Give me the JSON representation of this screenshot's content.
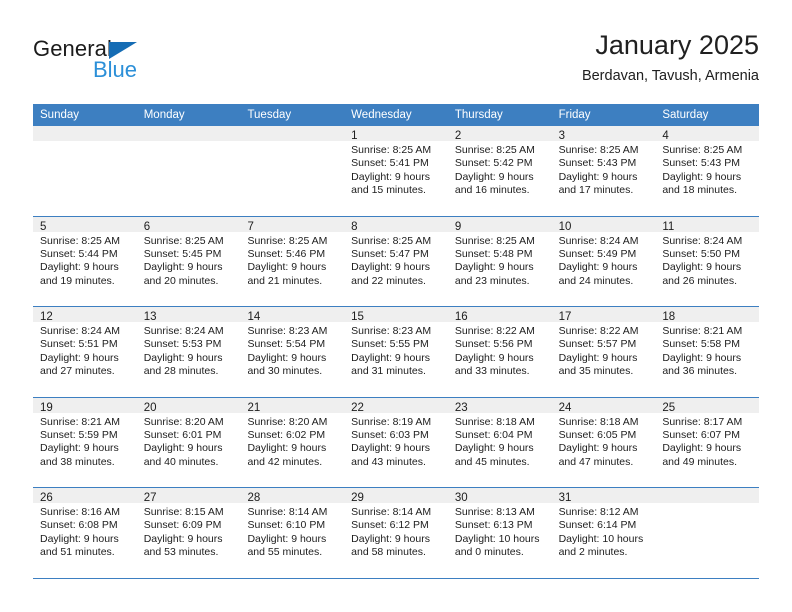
{
  "brand": {
    "name_part1": "General",
    "name_part2": "Blue",
    "logo_icon": "triangle-logo-icon",
    "accent_color": "#2b8fd8",
    "triangle_color": "#156cb4"
  },
  "header": {
    "title": "January 2025",
    "location": "Berdavan, Tavush, Armenia"
  },
  "calendar": {
    "header_bg": "#3d7fc1",
    "day_band_bg": "#efefef",
    "weekdays": [
      "Sunday",
      "Monday",
      "Tuesday",
      "Wednesday",
      "Thursday",
      "Friday",
      "Saturday"
    ],
    "weeks": [
      [
        {
          "day": "",
          "lines": []
        },
        {
          "day": "",
          "lines": []
        },
        {
          "day": "",
          "lines": []
        },
        {
          "day": "1",
          "lines": [
            "Sunrise: 8:25 AM",
            "Sunset: 5:41 PM",
            "Daylight: 9 hours",
            "and 15 minutes."
          ]
        },
        {
          "day": "2",
          "lines": [
            "Sunrise: 8:25 AM",
            "Sunset: 5:42 PM",
            "Daylight: 9 hours",
            "and 16 minutes."
          ]
        },
        {
          "day": "3",
          "lines": [
            "Sunrise: 8:25 AM",
            "Sunset: 5:43 PM",
            "Daylight: 9 hours",
            "and 17 minutes."
          ]
        },
        {
          "day": "4",
          "lines": [
            "Sunrise: 8:25 AM",
            "Sunset: 5:43 PM",
            "Daylight: 9 hours",
            "and 18 minutes."
          ]
        }
      ],
      [
        {
          "day": "5",
          "lines": [
            "Sunrise: 8:25 AM",
            "Sunset: 5:44 PM",
            "Daylight: 9 hours",
            "and 19 minutes."
          ]
        },
        {
          "day": "6",
          "lines": [
            "Sunrise: 8:25 AM",
            "Sunset: 5:45 PM",
            "Daylight: 9 hours",
            "and 20 minutes."
          ]
        },
        {
          "day": "7",
          "lines": [
            "Sunrise: 8:25 AM",
            "Sunset: 5:46 PM",
            "Daylight: 9 hours",
            "and 21 minutes."
          ]
        },
        {
          "day": "8",
          "lines": [
            "Sunrise: 8:25 AM",
            "Sunset: 5:47 PM",
            "Daylight: 9 hours",
            "and 22 minutes."
          ]
        },
        {
          "day": "9",
          "lines": [
            "Sunrise: 8:25 AM",
            "Sunset: 5:48 PM",
            "Daylight: 9 hours",
            "and 23 minutes."
          ]
        },
        {
          "day": "10",
          "lines": [
            "Sunrise: 8:24 AM",
            "Sunset: 5:49 PM",
            "Daylight: 9 hours",
            "and 24 minutes."
          ]
        },
        {
          "day": "11",
          "lines": [
            "Sunrise: 8:24 AM",
            "Sunset: 5:50 PM",
            "Daylight: 9 hours",
            "and 26 minutes."
          ]
        }
      ],
      [
        {
          "day": "12",
          "lines": [
            "Sunrise: 8:24 AM",
            "Sunset: 5:51 PM",
            "Daylight: 9 hours",
            "and 27 minutes."
          ]
        },
        {
          "day": "13",
          "lines": [
            "Sunrise: 8:24 AM",
            "Sunset: 5:53 PM",
            "Daylight: 9 hours",
            "and 28 minutes."
          ]
        },
        {
          "day": "14",
          "lines": [
            "Sunrise: 8:23 AM",
            "Sunset: 5:54 PM",
            "Daylight: 9 hours",
            "and 30 minutes."
          ]
        },
        {
          "day": "15",
          "lines": [
            "Sunrise: 8:23 AM",
            "Sunset: 5:55 PM",
            "Daylight: 9 hours",
            "and 31 minutes."
          ]
        },
        {
          "day": "16",
          "lines": [
            "Sunrise: 8:22 AM",
            "Sunset: 5:56 PM",
            "Daylight: 9 hours",
            "and 33 minutes."
          ]
        },
        {
          "day": "17",
          "lines": [
            "Sunrise: 8:22 AM",
            "Sunset: 5:57 PM",
            "Daylight: 9 hours",
            "and 35 minutes."
          ]
        },
        {
          "day": "18",
          "lines": [
            "Sunrise: 8:21 AM",
            "Sunset: 5:58 PM",
            "Daylight: 9 hours",
            "and 36 minutes."
          ]
        }
      ],
      [
        {
          "day": "19",
          "lines": [
            "Sunrise: 8:21 AM",
            "Sunset: 5:59 PM",
            "Daylight: 9 hours",
            "and 38 minutes."
          ]
        },
        {
          "day": "20",
          "lines": [
            "Sunrise: 8:20 AM",
            "Sunset: 6:01 PM",
            "Daylight: 9 hours",
            "and 40 minutes."
          ]
        },
        {
          "day": "21",
          "lines": [
            "Sunrise: 8:20 AM",
            "Sunset: 6:02 PM",
            "Daylight: 9 hours",
            "and 42 minutes."
          ]
        },
        {
          "day": "22",
          "lines": [
            "Sunrise: 8:19 AM",
            "Sunset: 6:03 PM",
            "Daylight: 9 hours",
            "and 43 minutes."
          ]
        },
        {
          "day": "23",
          "lines": [
            "Sunrise: 8:18 AM",
            "Sunset: 6:04 PM",
            "Daylight: 9 hours",
            "and 45 minutes."
          ]
        },
        {
          "day": "24",
          "lines": [
            "Sunrise: 8:18 AM",
            "Sunset: 6:05 PM",
            "Daylight: 9 hours",
            "and 47 minutes."
          ]
        },
        {
          "day": "25",
          "lines": [
            "Sunrise: 8:17 AM",
            "Sunset: 6:07 PM",
            "Daylight: 9 hours",
            "and 49 minutes."
          ]
        }
      ],
      [
        {
          "day": "26",
          "lines": [
            "Sunrise: 8:16 AM",
            "Sunset: 6:08 PM",
            "Daylight: 9 hours",
            "and 51 minutes."
          ]
        },
        {
          "day": "27",
          "lines": [
            "Sunrise: 8:15 AM",
            "Sunset: 6:09 PM",
            "Daylight: 9 hours",
            "and 53 minutes."
          ]
        },
        {
          "day": "28",
          "lines": [
            "Sunrise: 8:14 AM",
            "Sunset: 6:10 PM",
            "Daylight: 9 hours",
            "and 55 minutes."
          ]
        },
        {
          "day": "29",
          "lines": [
            "Sunrise: 8:14 AM",
            "Sunset: 6:12 PM",
            "Daylight: 9 hours",
            "and 58 minutes."
          ]
        },
        {
          "day": "30",
          "lines": [
            "Sunrise: 8:13 AM",
            "Sunset: 6:13 PM",
            "Daylight: 10 hours",
            "and 0 minutes."
          ]
        },
        {
          "day": "31",
          "lines": [
            "Sunrise: 8:12 AM",
            "Sunset: 6:14 PM",
            "Daylight: 10 hours",
            "and 2 minutes."
          ]
        },
        {
          "day": "",
          "lines": []
        }
      ]
    ]
  }
}
